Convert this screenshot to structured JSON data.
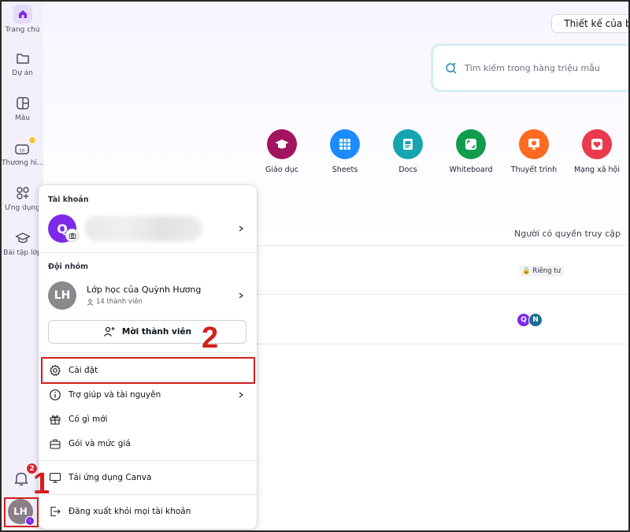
{
  "sidebar": {
    "items": [
      {
        "label": "Trang chủ",
        "icon": "home-icon"
      },
      {
        "label": "Dự án",
        "icon": "folder-icon"
      },
      {
        "label": "Mẫu",
        "icon": "template-icon"
      },
      {
        "label": "Thương hi...",
        "icon": "brand-icon"
      },
      {
        "label": "Ứng dụng",
        "icon": "apps-icon"
      },
      {
        "label": "Bài tập lớp",
        "icon": "graduation-cap-icon"
      }
    ],
    "notification_count": "2",
    "user_initials": "LH"
  },
  "header": {
    "design_button_label": "Thiết kế của bạ"
  },
  "search": {
    "placeholder": "Tìm kiếm trong hàng triệu mẫu"
  },
  "categories": [
    {
      "label": "Giáo dục",
      "color": "#a3145f",
      "icon": "graduation-cap-icon"
    },
    {
      "label": "Sheets",
      "color": "#1a8cff",
      "icon": "table-icon"
    },
    {
      "label": "Docs",
      "color": "#15a5b0",
      "icon": "doc-icon"
    },
    {
      "label": "Whiteboard",
      "color": "#0f9d4d",
      "icon": "whiteboard-icon"
    },
    {
      "label": "Thuyết trình",
      "color": "#ff6a21",
      "icon": "presentation-icon"
    },
    {
      "label": "Mạng xã hội",
      "color": "#e93b4e",
      "icon": "heart-icon"
    }
  ],
  "table": {
    "access_header": "Người có quyền truy cập",
    "rows": [
      {
        "access": "Riêng tư"
      },
      {
        "access_avatars": [
          "Q",
          "N"
        ]
      }
    ]
  },
  "menu": {
    "account_section": "Tài khoản",
    "account_initial": "Q",
    "team_section": "Đội nhóm",
    "team_initials": "LH",
    "team_name": "Lớp học của Quỳnh Hương",
    "team_members": "14 thành viên",
    "invite_label": "Mời thành viên",
    "items": [
      {
        "label": "Cài đặt",
        "icon": "gear-icon"
      },
      {
        "label": "Trợ giúp và tài nguyên",
        "icon": "info-icon"
      },
      {
        "label": "Có gì mới",
        "icon": "gift-icon"
      },
      {
        "label": "Gói và mức giá",
        "icon": "briefcase-icon"
      },
      {
        "label": "Tải ứng dụng Canva",
        "icon": "monitor-icon"
      },
      {
        "label": "Đăng xuất khỏi mọi tài khoản",
        "icon": "logout-icon"
      }
    ]
  },
  "annotations": {
    "step1": "1",
    "step2": "2",
    "highlight_color": "#d31f1f"
  }
}
